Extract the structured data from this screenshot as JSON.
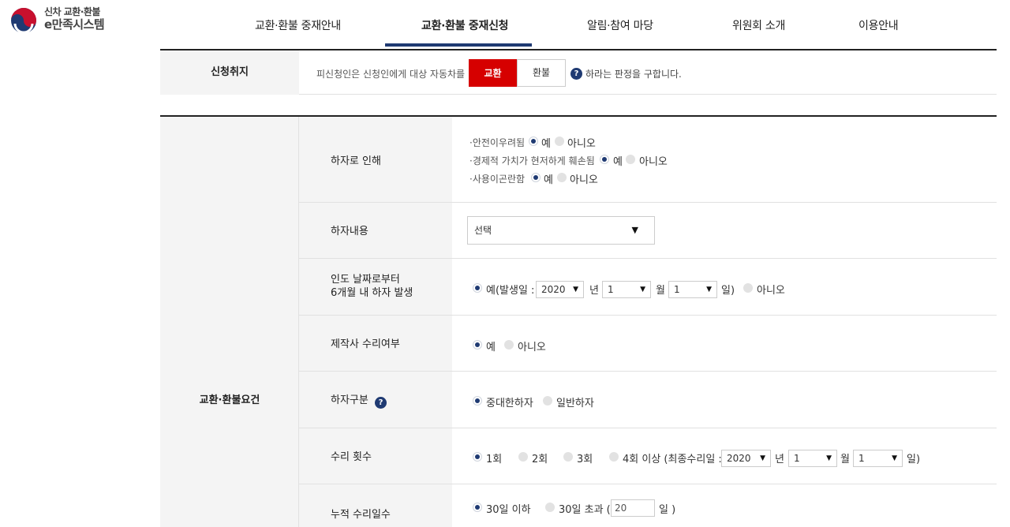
{
  "header": {
    "logo_line1": "신차 교환·환불",
    "logo_line2": "e만족시스템",
    "nav": [
      "교환·환불 중재안내",
      "교환·환불 중재신청",
      "알림·참여 마당",
      "위원회 소개",
      "이용안내"
    ],
    "active_index": 1
  },
  "purpose": {
    "label": "신청취지",
    "text": "피신청인은 신청인에게 대상 자동차를",
    "exchange_label": "교환",
    "refund_label": "환불",
    "help_symbol": "?",
    "tail": "하라는 판정을 구합니다.",
    "selected": "교환"
  },
  "requirements": {
    "group_label": "교환·환불요건",
    "defect": {
      "label": "하자로 인해",
      "items": [
        {
          "text": "·안전이우려됨",
          "yes": "예",
          "no": "아니오",
          "selected": "예"
        },
        {
          "text": "·경제적 가치가 현저하게 훼손됨",
          "yes": "예",
          "no": "아니오",
          "selected": "예"
        },
        {
          "text": "·사용이곤란함",
          "yes": "예",
          "no": "아니오",
          "selected": "예"
        }
      ]
    },
    "defect_content": {
      "label": "하자내용",
      "value": "선택"
    },
    "within6": {
      "label_line1": "인도 날짜로부터",
      "label_line2": "6개월 내 하자 발생",
      "yes_label": "예(발생일 :",
      "year": "2020",
      "year_unit": "년",
      "month": "1",
      "month_unit": "월",
      "day": "1",
      "day_unit": "일)",
      "no_label": "아니오",
      "selected": "예"
    },
    "manufacturer_repair": {
      "label": "제작사 수리여부",
      "yes": "예",
      "no": "아니오",
      "selected": "예"
    },
    "defect_type": {
      "label": "하자구분",
      "help_symbol": "?",
      "options": [
        "중대한하자",
        "일반하자"
      ],
      "selected": "중대한하자"
    },
    "repair_count": {
      "label": "수리 횟수",
      "options": [
        "1회",
        "2회",
        "3회",
        "4회 이상 (최종수리일 :"
      ],
      "selected": "1회",
      "year": "2020",
      "year_unit": "년",
      "month": "1",
      "month_unit": "월",
      "day": "1",
      "day_unit": "일)"
    },
    "repair_days": {
      "label": "누적 수리일수",
      "opt1": "30일 이하",
      "opt2": "30일 초과 (",
      "days": "20",
      "unit": "일 )",
      "selected": "30일 이하"
    }
  },
  "colors": {
    "accent": "#1f3a72",
    "exchange": "#d60000",
    "label_bg": "#f4f4f4"
  }
}
